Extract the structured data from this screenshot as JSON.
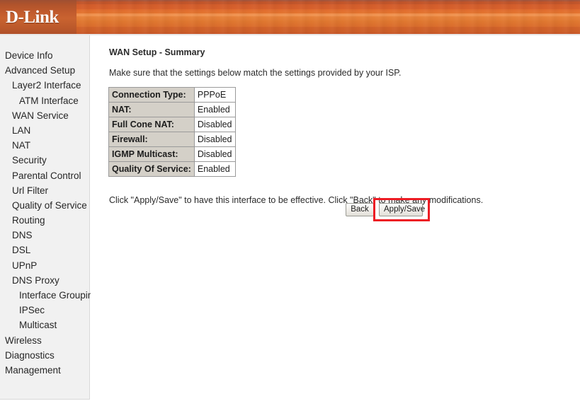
{
  "banner": {
    "logo_text": "D-Link",
    "brand_color": "#d2632a",
    "logo_plate_color": "#b0532c"
  },
  "sidebar": {
    "items": [
      {
        "label": "Device Info",
        "level": 0
      },
      {
        "label": "Advanced Setup",
        "level": 0
      },
      {
        "label": "Layer2 Interface",
        "level": 1
      },
      {
        "label": "ATM Interface",
        "level": 2
      },
      {
        "label": "WAN Service",
        "level": 1
      },
      {
        "label": "LAN",
        "level": 1
      },
      {
        "label": "NAT",
        "level": 1
      },
      {
        "label": "Security",
        "level": 1
      },
      {
        "label": "Parental Control",
        "level": 1
      },
      {
        "label": "Url Filter",
        "level": 1
      },
      {
        "label": "Quality of Service",
        "level": 1
      },
      {
        "label": "Routing",
        "level": 1
      },
      {
        "label": "DNS",
        "level": 1
      },
      {
        "label": "DSL",
        "level": 1
      },
      {
        "label": "UPnP",
        "level": 1
      },
      {
        "label": "DNS Proxy",
        "level": 1
      },
      {
        "label": "Interface Grouping",
        "level": 2
      },
      {
        "label": "IPSec",
        "level": 2
      },
      {
        "label": "Multicast",
        "level": 2
      },
      {
        "label": "Wireless",
        "level": 0
      },
      {
        "label": "Diagnostics",
        "level": 0
      },
      {
        "label": "Management",
        "level": 0
      }
    ]
  },
  "main": {
    "title": "WAN Setup - Summary",
    "description": "Make sure that the settings below match the settings provided by your ISP.",
    "summary_rows": [
      {
        "label": "Connection Type:",
        "value": "PPPoE"
      },
      {
        "label": "NAT:",
        "value": "Enabled"
      },
      {
        "label": "Full Cone NAT:",
        "value": "Disabled"
      },
      {
        "label": "Firewall:",
        "value": "Disabled"
      },
      {
        "label": "IGMP Multicast:",
        "value": "Disabled"
      },
      {
        "label": "Quality Of Service:",
        "value": "Enabled"
      }
    ],
    "footer_note": "Click \"Apply/Save\" to have this interface to be effective. Click \"Back\" to make any modifications.",
    "buttons": {
      "back_label": "Back",
      "apply_label": "Apply/Save"
    },
    "highlight_color": "#ed1c24"
  }
}
